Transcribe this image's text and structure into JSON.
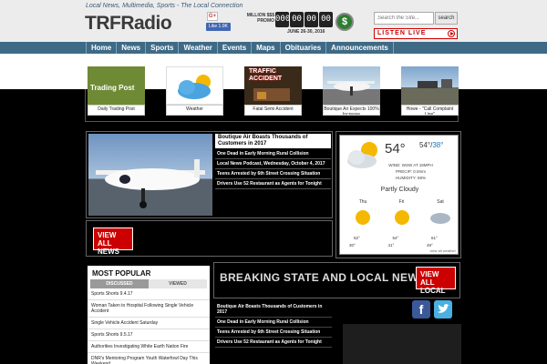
{
  "header": {
    "tagline": "Local News, Multimedia, Sports - The Local Connection",
    "logo": "TRFRadio",
    "gplus": "G+",
    "fb_like": "Like 1.0K",
    "fb_count": "",
    "million_label": "MILLION $$$ PROMO",
    "counter": [
      "000",
      "00",
      "00",
      "00"
    ],
    "date": "JUNE 26-30, 2016",
    "search_placeholder": "Search the Site...",
    "search_button": "search",
    "listen_live": "LISTEN LIVE"
  },
  "nav": {
    "items": [
      "Home",
      "News",
      "Sports",
      "Weather",
      "Events",
      "Maps",
      "Obituaries",
      "Announcements"
    ]
  },
  "thumbs": [
    {
      "caption": "Daily Trading Post",
      "overlay": "Trading Post"
    },
    {
      "caption": "Weather",
      "overlay": ""
    },
    {
      "caption": "Fatal Semi Accident",
      "overlay": "TRAFFIC ACCIDENT"
    },
    {
      "caption": "Boutique Air Expects 100% Increase",
      "overlay": ""
    },
    {
      "caption": "Howe - \"Call Complaint Line\"",
      "overlay": ""
    }
  ],
  "featured": {
    "headline": "Boutique Air Boasts Thousands of Customers in 2017",
    "items": [
      "One Dead in Early Morning Rural Collision",
      "Local News Podcast, Wednesday, October 4, 2017",
      "Teens Arrested by 6th Street Crossing Situation",
      "Drivers Use 52 Restaurant as Agents for Tonight"
    ],
    "view_all": "VIEW ALL NEWS"
  },
  "weather": {
    "temp": "54°",
    "hi": "54°",
    "lo": "38°",
    "wind": "WIND: WSW AT 18MPH",
    "precip": "PRECIP: 0.0mm",
    "humidity": "HUMIDITY: 69%",
    "condition": "Partly Cloudy",
    "days": [
      {
        "name": "Thu",
        "lo": "52°",
        "hi": "30°"
      },
      {
        "name": "Fri",
        "lo": "54°",
        "hi": "41°"
      },
      {
        "name": "Sat",
        "lo": "61°",
        "hi": "49°"
      }
    ],
    "credit": "view all weather"
  },
  "popular": {
    "title": "MOST POPULAR",
    "tabs": [
      "DISCUSSED",
      "VIEWED"
    ],
    "items": [
      "Sports Shorts 9.4.17",
      "Woman Taken to Hospital Following Single Vehicle Accident",
      "Single Vehicle Accident Saturday",
      "Sports Shorts 9.5.17",
      "Authorities Investigating White Earth Nation Fire",
      "DNR's Mentoring Program Youth Waterfowl Day This Weekend"
    ]
  },
  "breaking": {
    "title": "BREAKING STATE AND LOCAL NEWS",
    "view_all": "VIEW ALL LOCAL",
    "items": [
      "Boutique Air Boasts Thousands of Customers in 2017",
      "One Dead in Early Morning Rural Collision",
      "Teens Arrested by 6th Street Crossing Situation",
      "Drivers Use 52 Restaurant as Agents for Tonight"
    ]
  },
  "colors": {
    "nav": "#3e6a86",
    "accent_red": "#cc0000",
    "facebook": "#3b5998",
    "twitter": "#49b0e3"
  }
}
